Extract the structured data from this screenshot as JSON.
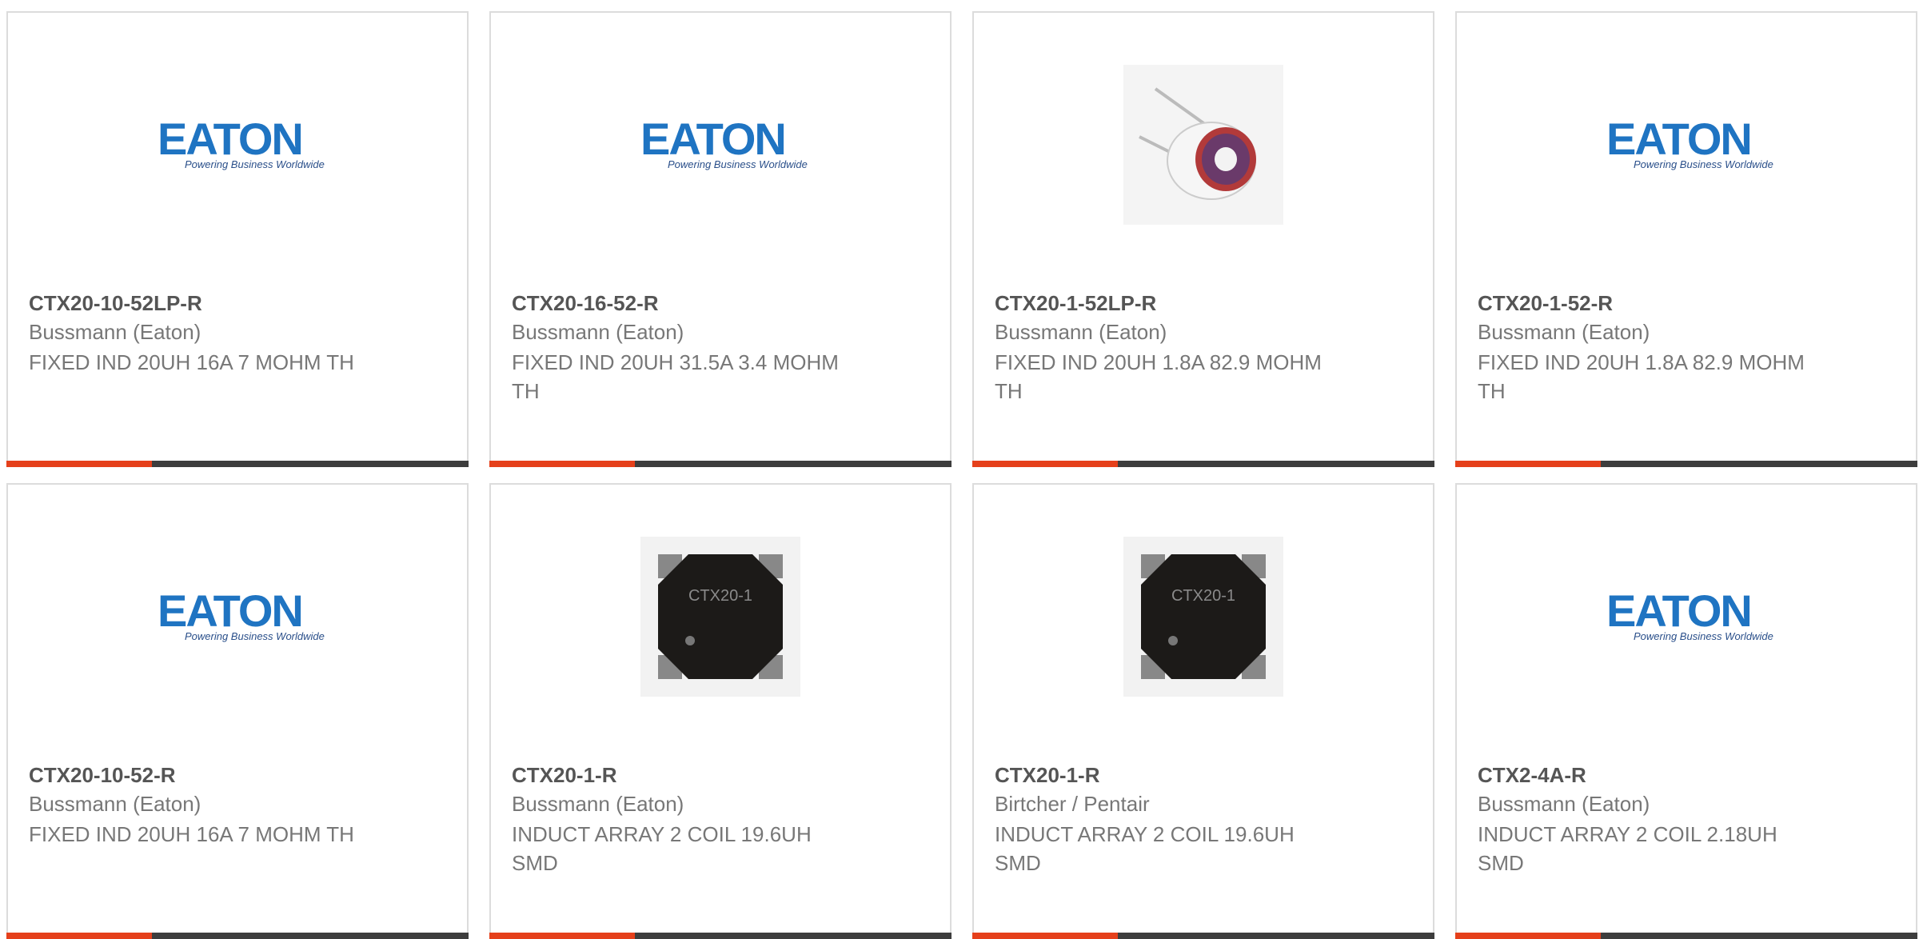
{
  "cards": [
    {
      "part": "CTX20-10-52LP-R",
      "manufacturer": "Bussmann (Eaton)",
      "description": "FIXED IND 20UH 16A 7 MOHM TH",
      "image": "eaton-logo"
    },
    {
      "part": "CTX20-16-52-R",
      "manufacturer": "Bussmann (Eaton)",
      "description": "FIXED IND 20UH 31.5A 3.4 MOHM TH",
      "image": "eaton-logo"
    },
    {
      "part": "CTX20-1-52LP-R",
      "manufacturer": "Bussmann (Eaton)",
      "description": "FIXED IND 20UH 1.8A 82.9 MOHM TH",
      "image": "toroid-inductor-photo"
    },
    {
      "part": "CTX20-1-52-R",
      "manufacturer": "Bussmann (Eaton)",
      "description": "FIXED IND 20UH 1.8A 82.9 MOHM TH",
      "image": "eaton-logo"
    },
    {
      "part": "CTX20-10-52-R",
      "manufacturer": "Bussmann (Eaton)",
      "description": "FIXED IND 20UH 16A 7 MOHM TH",
      "image": "eaton-logo"
    },
    {
      "part": "CTX20-1-R",
      "manufacturer": "Bussmann (Eaton)",
      "description": "INDUCT ARRAY 2 COIL 19.6UH SMD",
      "image": "smd-inductor-photo"
    },
    {
      "part": "CTX20-1-R",
      "manufacturer": "Birtcher / Pentair",
      "description": "INDUCT ARRAY 2 COIL 19.6UH SMD",
      "image": "smd-inductor-photo"
    },
    {
      "part": "CTX2-4A-R",
      "manufacturer": "Bussmann (Eaton)",
      "description": "INDUCT ARRAY 2 COIL 2.18UH SMD",
      "image": "eaton-logo"
    }
  ],
  "logo": {
    "wordmark": "EATON",
    "tagline": "Powering Business Worldwide"
  },
  "smd_marking": "CTX20-1",
  "colors": {
    "accent": "#e5401b",
    "bar": "#3d3d3d",
    "eaton_blue": "#1f74c2",
    "border": "#dcdcdc",
    "text_bold": "#555555",
    "text": "#777777"
  }
}
